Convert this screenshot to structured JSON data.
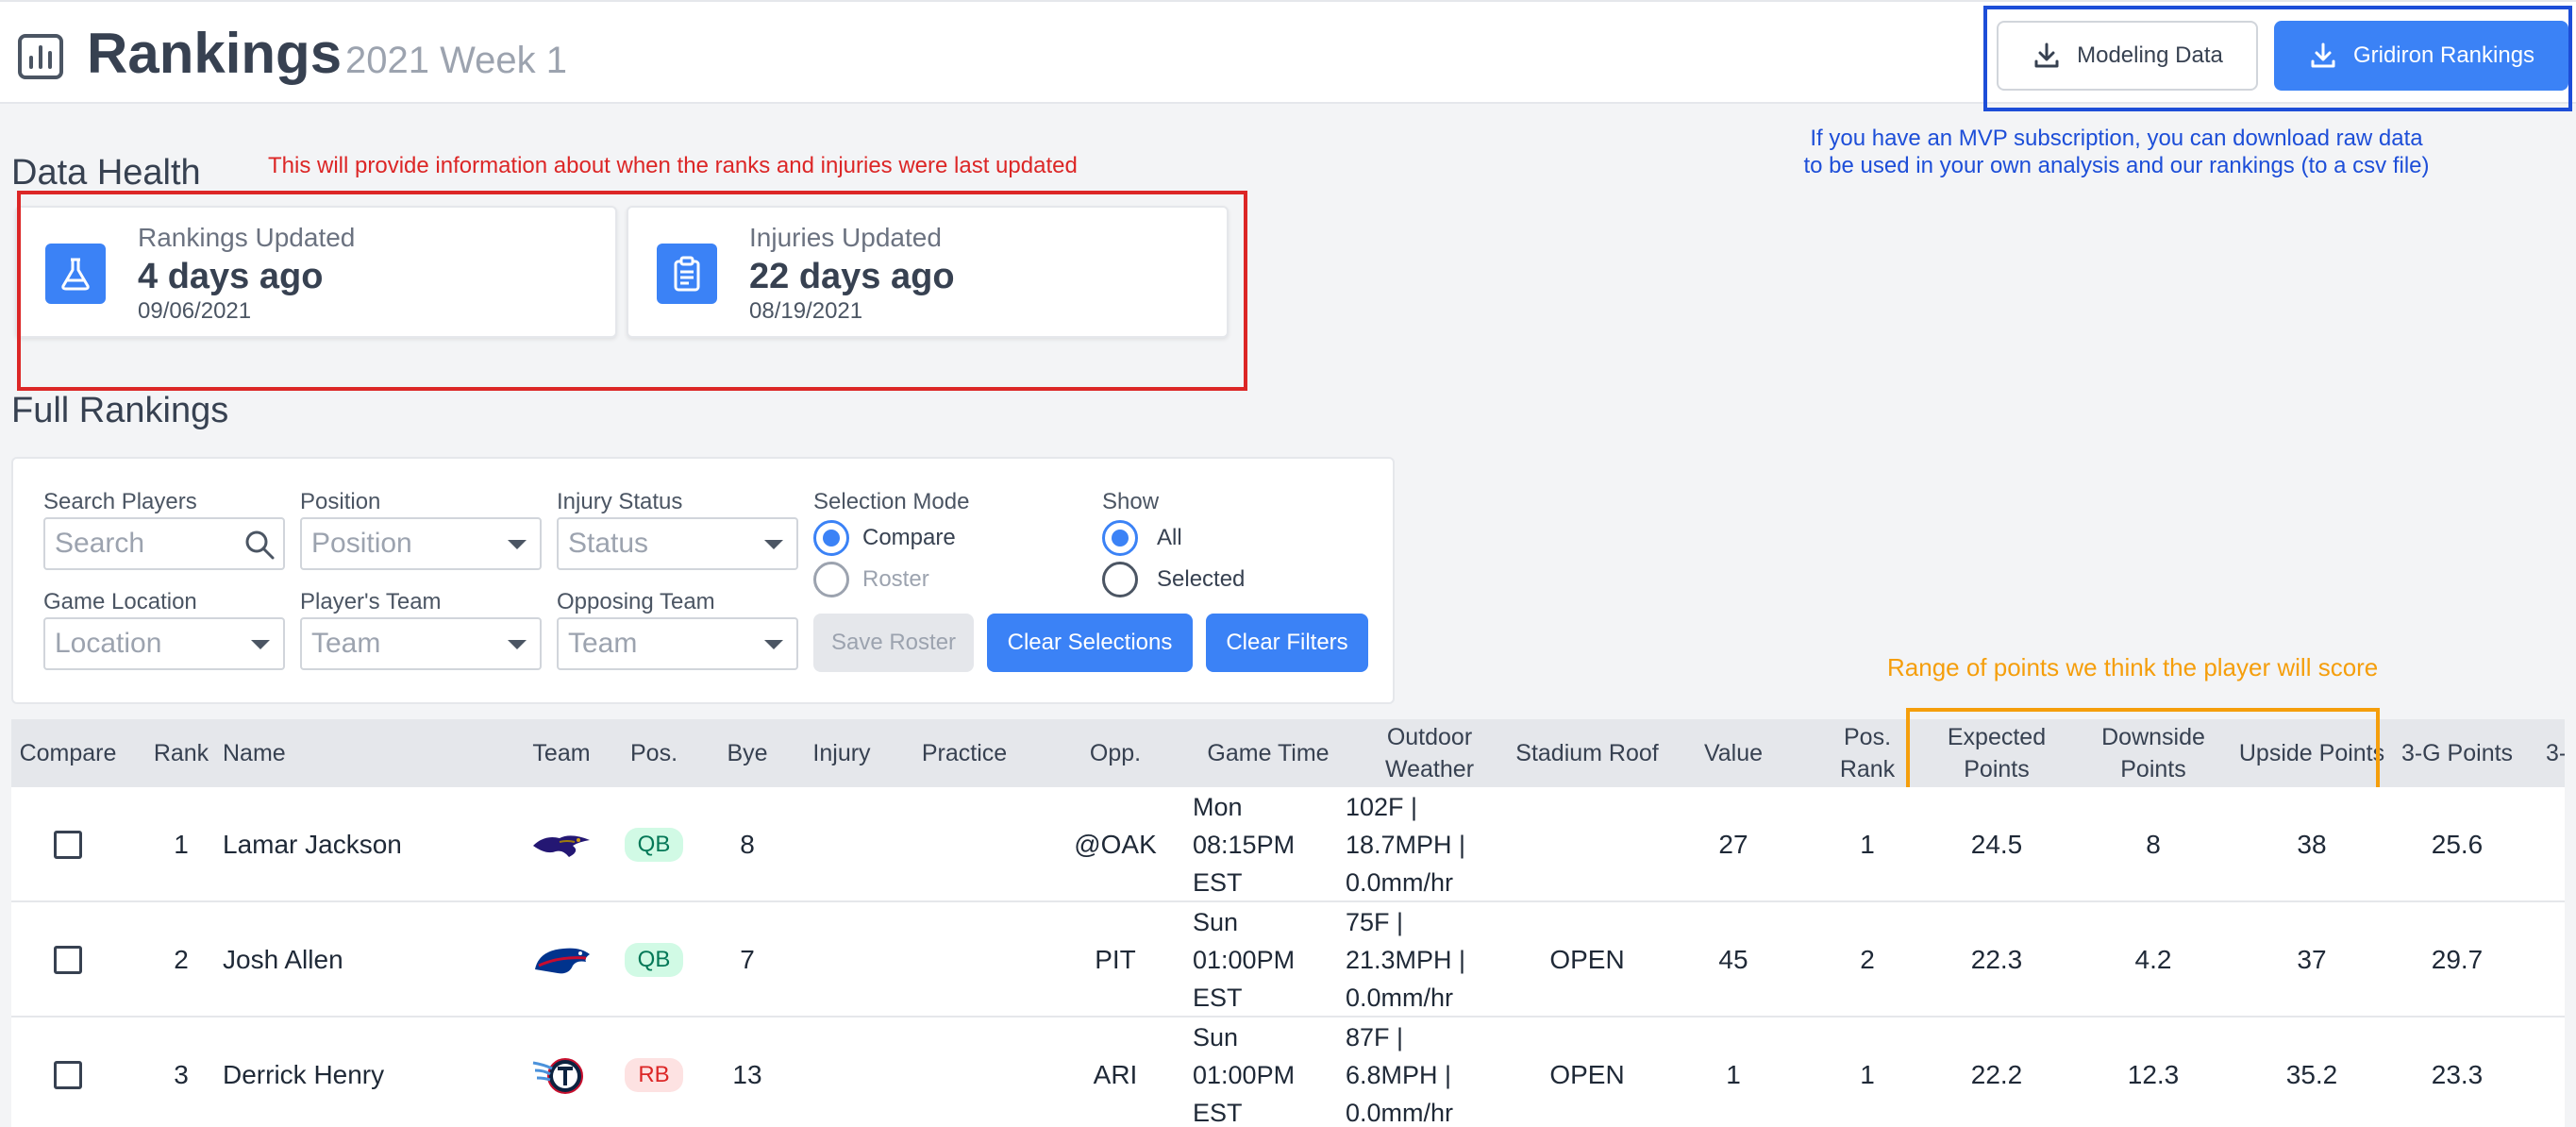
{
  "header": {
    "title": "Rankings",
    "subtitle": "2021 Week 1",
    "btn_modeling": "Modeling Data",
    "btn_gridiron": "Gridiron Rankings"
  },
  "annotations": {
    "blue": "If you have an MVP subscription, you can download raw data to be used in your own analysis and our rankings (to a csv file)",
    "red": "This will provide information about when the ranks and injuries were last updated",
    "orange": "Range of points we think the player will score"
  },
  "data_health": {
    "title": "Data Health",
    "cards": [
      {
        "label": "Rankings Updated",
        "value": "4 days ago",
        "date": "09/06/2021",
        "icon": "flask-icon"
      },
      {
        "label": "Injuries Updated",
        "value": "22 days ago",
        "date": "08/19/2021",
        "icon": "clipboard-icon"
      }
    ]
  },
  "full_rankings": {
    "title": "Full Rankings",
    "filters": {
      "search_label": "Search Players",
      "search_placeholder": "Search",
      "position_label": "Position",
      "position_value": "Position",
      "injury_label": "Injury Status",
      "injury_value": "Status",
      "location_label": "Game Location",
      "location_value": "Location",
      "team_label": "Player's Team",
      "team_value": "Team",
      "opp_label": "Opposing Team",
      "opp_value": "Team",
      "mode_label": "Selection Mode",
      "mode_compare": "Compare",
      "mode_roster": "Roster",
      "show_label": "Show",
      "show_all": "All",
      "show_selected": "Selected",
      "save_roster": "Save Roster",
      "clear_selections": "Clear Selections",
      "clear_filters": "Clear Filters"
    }
  },
  "table": {
    "columns": [
      "Compare",
      "Rank",
      "Name",
      "Team",
      "Pos.",
      "Bye",
      "Injury",
      "Practice",
      "Opp.",
      "Game Time",
      "Outdoor Weather",
      "Stadium Roof",
      "Value",
      "Pos. Rank",
      "Expected Points",
      "Downside Points",
      "Upside Points",
      "3-G Points",
      "3-"
    ],
    "rows": [
      {
        "rank": "1",
        "name": "Lamar Jackson",
        "team": "BAL",
        "pos": "QB",
        "bye": "8",
        "injury": "",
        "practice": "",
        "opp": "@OAK",
        "time1": "Mon",
        "time2": "08:15PM",
        "time3": "EST",
        "w1": "102F |",
        "w2": "18.7MPH |",
        "w3": "0.0mm/hr",
        "roof": "",
        "value": "27",
        "pos_rank": "1",
        "expected": "24.5",
        "downside": "8",
        "upside": "38",
        "three_g": "25.6"
      },
      {
        "rank": "2",
        "name": "Josh Allen",
        "team": "BUF",
        "pos": "QB",
        "bye": "7",
        "injury": "",
        "practice": "",
        "opp": "PIT",
        "time1": "Sun",
        "time2": "01:00PM",
        "time3": "EST",
        "w1": "75F |",
        "w2": "21.3MPH |",
        "w3": "0.0mm/hr",
        "roof": "OPEN",
        "value": "45",
        "pos_rank": "2",
        "expected": "22.3",
        "downside": "4.2",
        "upside": "37",
        "three_g": "29.7"
      },
      {
        "rank": "3",
        "name": "Derrick Henry",
        "team": "TEN",
        "pos": "RB",
        "bye": "13",
        "injury": "",
        "practice": "",
        "opp": "ARI",
        "time1": "Sun",
        "time2": "01:00PM",
        "time3": "EST",
        "w1": "87F |",
        "w2": "6.8MPH |",
        "w3": "0.0mm/hr",
        "roof": "OPEN",
        "value": "1",
        "pos_rank": "1",
        "expected": "22.2",
        "downside": "12.3",
        "upside": "35.2",
        "three_g": "23.3"
      }
    ]
  }
}
